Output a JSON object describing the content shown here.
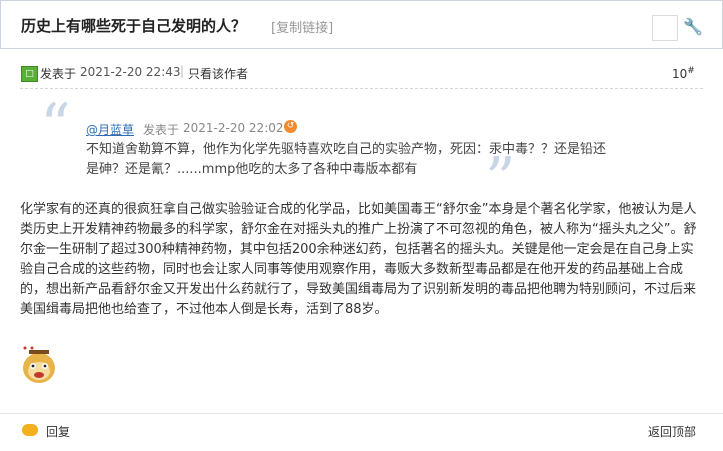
{
  "thread": {
    "title": "历史上有哪些死于自己发明的人？",
    "copy_link": "[复制链接]"
  },
  "post": {
    "posted_label": "发表于",
    "date": "2021-2-20 22:43",
    "separator": "|",
    "only_author": "只看该作者",
    "floor": "10",
    "floor_suffix": "#",
    "quote": {
      "user": "@月蓝草",
      "posted_label": "发表于",
      "date": "2021-2-20 22:02",
      "text": "不知道舍勒算不算，他作为化学先驱特喜欢吃自己的实验产物，死因：汞中毒？？还是铅还是砷？还是氰？......mmp他吃的太多了各种中毒版本都有"
    },
    "body": "化学家有的还真的很疯狂拿自己做实验验证合成的化学品，比如美国毒王“舒尔金”本身是个著名化学家，他被认为是人类历史上开发精神药物最多的科学家，舒尔金在对摇头丸的推广上扮演了不可忽视的角色，被人称为“摇头丸之父”。舒尔金一生研制了超过300种精神药物，其中包括200余种迷幻药，包括著名的摇头丸。关键是他一定会是在自己身上实验自己合成的这些药物，同时也会让家人同事等使用观察作用，毒贩大多数新型毒品都是在他开发的药品基础上合成的，想出新产品看舒尔金又开发出什么药就行了，导致美国缉毒局为了识别新发明的毒品把他聘为特别顾问，不过后来美国缉毒局把他也给查了，不过他本人倒是长寿，活到了88岁。"
  },
  "footer": {
    "reply": "回复",
    "back_top": "返回顶部"
  },
  "colors": {
    "link": "#2a6db3",
    "quote_mark": "#c9d6e6",
    "post_icon": "#5cae3b"
  },
  "icons": [
    "post-icon",
    "wrench-icon",
    "reply-icon",
    "quote-open-icon",
    "quote-close-icon",
    "emoji-sticker"
  ]
}
